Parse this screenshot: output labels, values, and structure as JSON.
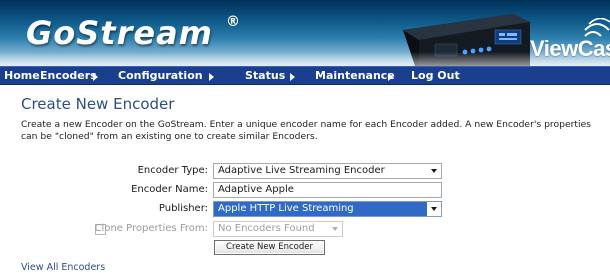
{
  "header": {
    "logo": "GoStream",
    "registered_mark": "®",
    "brand": "ViewCas"
  },
  "nav": {
    "items": [
      {
        "label": "Home"
      },
      {
        "label": "Encoders"
      },
      {
        "label": "Configuration"
      },
      {
        "label": "Status"
      },
      {
        "label": "Maintenance"
      },
      {
        "label": "Log Out"
      }
    ]
  },
  "page": {
    "title": "Create New Encoder",
    "description": "Create a new Encoder on the GoStream. Enter a unique encoder name for each Encoder added. A new Encoder's properties can be \"cloned\" from an existing one to create similar Encoders."
  },
  "form": {
    "encoder_type_label": "Encoder Type:",
    "encoder_type_value": "Adaptive Live Streaming Encoder",
    "encoder_name_label": "Encoder Name:",
    "encoder_name_value": "Adaptive Apple",
    "publisher_label": "Publisher:",
    "publisher_value": "Apple HTTP Live Streaming",
    "clone_label": "Clone Properties From:",
    "clone_value": "No Encoders Found",
    "submit_label": "Create New Encoder"
  },
  "links": {
    "view_all": "View All Encoders"
  },
  "colors": {
    "nav_bg": "#1a3f8f",
    "title_blue": "#2c4e86",
    "selection_blue": "#3169c6"
  }
}
